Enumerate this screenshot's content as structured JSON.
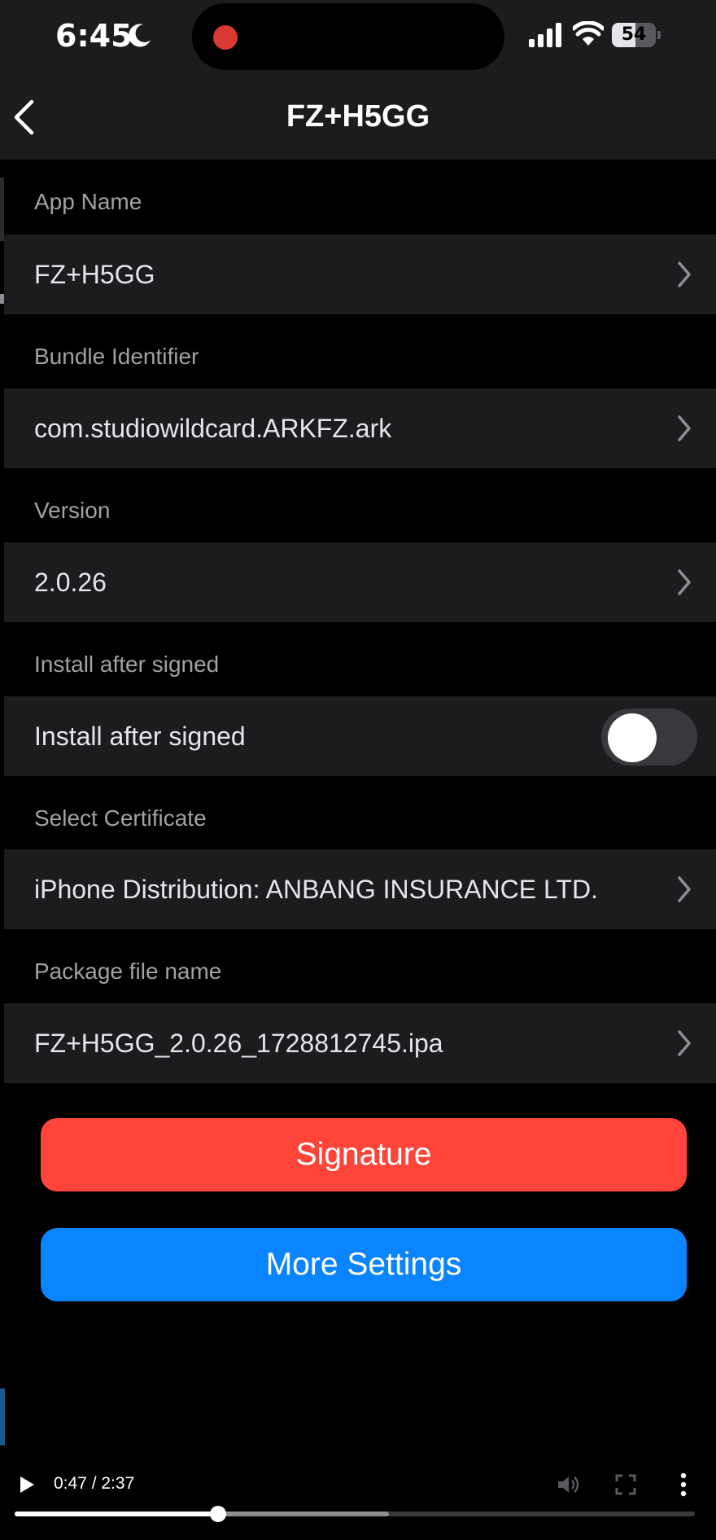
{
  "status_bar": {
    "time": "6:45",
    "battery": "54",
    "battery_fraction": 0.54
  },
  "nav": {
    "title": "FZ+H5GG"
  },
  "sections": {
    "app_name": {
      "header": "App Name",
      "value": "FZ+H5GG"
    },
    "bundle_id": {
      "header": "Bundle Identifier",
      "value": "com.studiowildcard.ARKFZ.ark"
    },
    "version": {
      "header": "Version",
      "value": "2.0.26"
    },
    "install": {
      "header": "Install after signed",
      "label": "Install after signed",
      "enabled": false
    },
    "certificate": {
      "header": "Select Certificate",
      "value": "iPhone Distribution: ANBANG INSURANCE LTD."
    },
    "package": {
      "header": "Package file name",
      "value": "FZ+H5GG_2.0.26_1728812745.ipa"
    }
  },
  "buttons": {
    "signature": "Signature",
    "more_settings": "More Settings"
  },
  "video": {
    "time": "0:47 / 2:37",
    "played_fraction": 0.299,
    "buffered_fraction": 0.55
  },
  "colors": {
    "signature_button": "#ff453a",
    "more_settings_button": "#0a84ff",
    "row_background": "#1c1c1e",
    "page_background": "#000000"
  },
  "icons": {
    "back": "chevron-left-icon",
    "row_disclosure": "chevron-right-icon",
    "play": "play-icon",
    "mute": "volume-icon",
    "fullscreen": "fullscreen-icon",
    "more": "more-vertical-icon"
  }
}
